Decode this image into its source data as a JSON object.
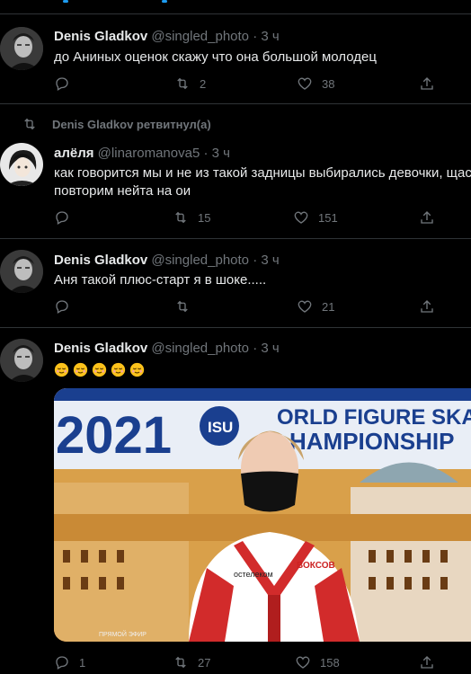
{
  "tweets": [
    {
      "name": "Denis Gladkov",
      "handle": "@singled_photo",
      "sep": "·",
      "time": "3 ч",
      "text": "до Аниных оценок скажу что она большой молодец",
      "replies": "",
      "retweets": "2",
      "likes": "38"
    },
    {
      "retweeted_by": "Denis Gladkov ретвитнул(а)",
      "name": "алёля",
      "handle": "@linaromanova5",
      "sep": "·",
      "time": "3 ч",
      "text_line1": "как говорится мы и не из такой задницы выбирались девочки, щас",
      "text_line2": "повторим нейта на ои",
      "replies": "",
      "retweets": "15",
      "likes": "151"
    },
    {
      "name": "Denis Gladkov",
      "handle": "@singled_photo",
      "sep": "·",
      "time": "3 ч",
      "text": "Аня такой плюс-старт я в шоке.....",
      "replies": "",
      "retweets": "",
      "likes": "21"
    },
    {
      "name": "Denis Gladkov",
      "handle": "@singled_photo",
      "sep": "·",
      "time": "3 ч",
      "emoji": [
        "relieved-face",
        "relieved-face",
        "relieved-face",
        "relieved-face",
        "relieved-face"
      ],
      "media": {
        "banner_year": "2021",
        "banner_text_line1": "ORLD FIGURE SKATI",
        "banner_text_line2": "HAMPIONSHIP",
        "isu_logo": "ISU",
        "jacket_sponsor_left": "остелеком",
        "jacket_sponsor_right": "ВОКСОВ",
        "live_label": "ПРЯМОЙ ЭФИР"
      },
      "replies": "1",
      "retweets": "27",
      "likes": "158"
    }
  ],
  "colors": {
    "background": "#000000",
    "divider": "#2f3336",
    "name": "#e7e9ea",
    "secondary": "#71767b",
    "accent": "#1d9bf0"
  }
}
